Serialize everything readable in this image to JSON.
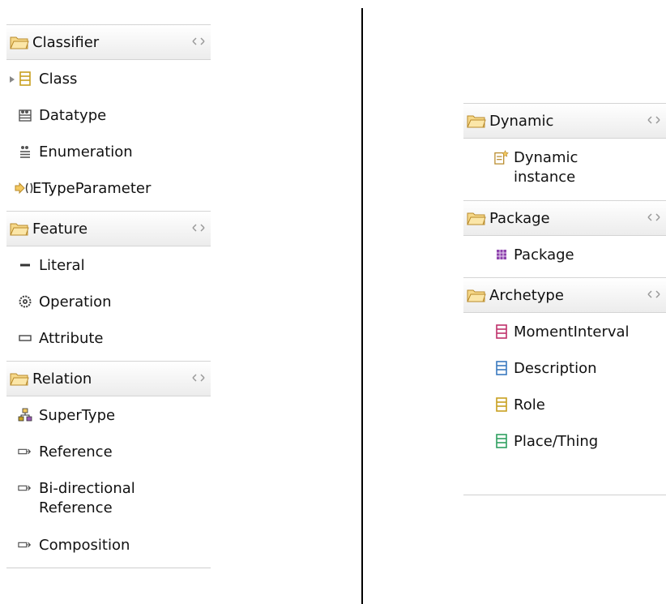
{
  "left_palette": {
    "classifier": {
      "title": "Classifier",
      "items": [
        {
          "label": "Class",
          "icon": "class-icon"
        },
        {
          "label": "Datatype",
          "icon": "datatype-icon"
        },
        {
          "label": "Enumeration",
          "icon": "enumeration-icon"
        },
        {
          "label": "ETypeParameter",
          "icon": "type-parameter-icon"
        }
      ]
    },
    "feature": {
      "title": "Feature",
      "items": [
        {
          "label": "Literal",
          "icon": "literal-icon"
        },
        {
          "label": "Operation",
          "icon": "operation-icon"
        },
        {
          "label": "Attribute",
          "icon": "attribute-icon"
        }
      ]
    },
    "relation": {
      "title": "Relation",
      "items": [
        {
          "label": "SuperType",
          "icon": "supertype-icon"
        },
        {
          "label": "Reference",
          "icon": "reference-icon"
        },
        {
          "label": "Bi-directional\nReference",
          "icon": "bidirectional-reference-icon"
        },
        {
          "label": "Composition",
          "icon": "composition-icon"
        }
      ]
    }
  },
  "right_palette": {
    "dynamic": {
      "title": "Dynamic",
      "items": [
        {
          "label": "Dynamic\ninstance",
          "icon": "dynamic-instance-icon"
        }
      ]
    },
    "package": {
      "title": "Package",
      "items": [
        {
          "label": "Package",
          "icon": "package-icon"
        }
      ]
    },
    "archetype": {
      "title": "Archetype",
      "items": [
        {
          "label": "MomentInterval",
          "icon": "class-icon",
          "color": "#c0306a"
        },
        {
          "label": "Description",
          "icon": "class-icon",
          "color": "#3a7ac0"
        },
        {
          "label": "Role",
          "icon": "class-icon",
          "color": "#c8a020"
        },
        {
          "label": "Place/Thing",
          "icon": "class-icon",
          "color": "#2fa060"
        }
      ]
    }
  },
  "colors": {
    "folder": "#f3c860",
    "class_default": "#c8a020"
  }
}
